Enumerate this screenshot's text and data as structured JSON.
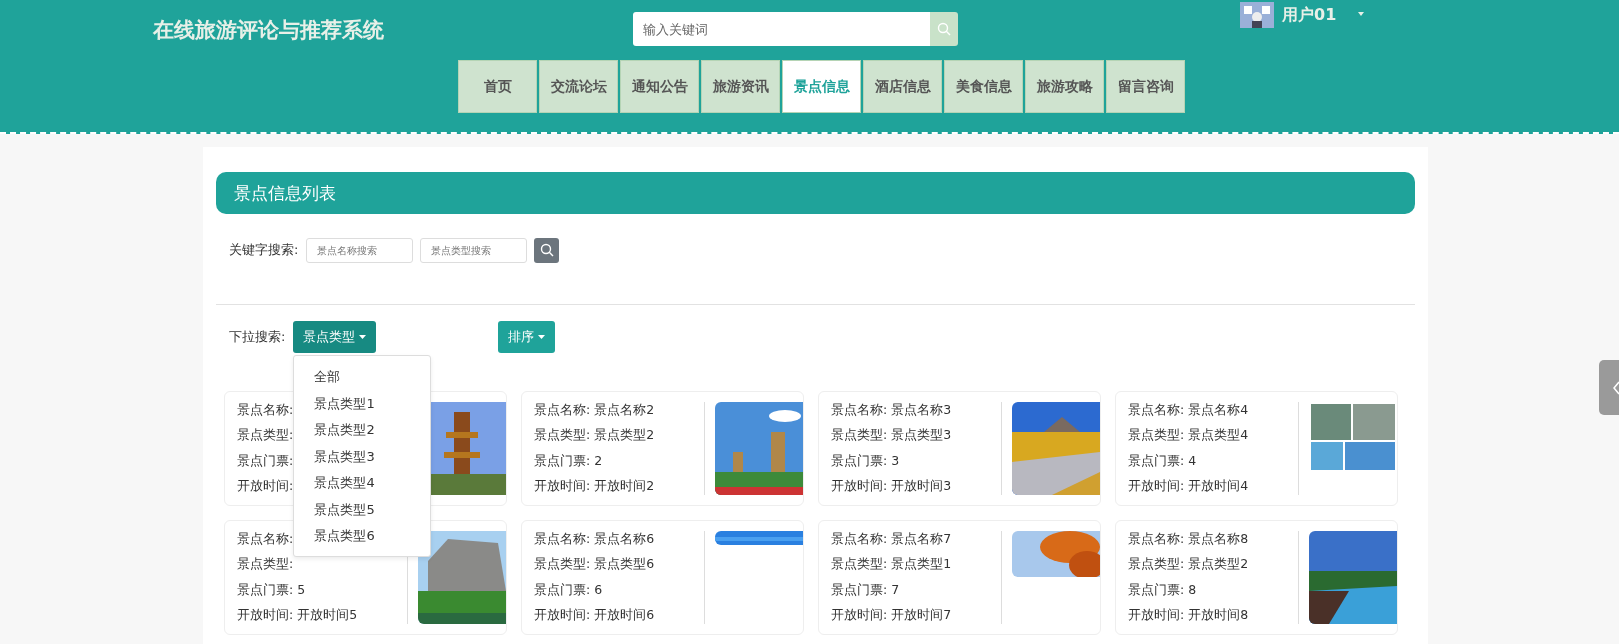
{
  "header": {
    "title": "在线旅游评论与推荐系统",
    "search": {
      "placeholder": "输入关键词"
    },
    "user": {
      "name": "用户01"
    }
  },
  "nav": [
    {
      "label": "首页",
      "selected": false
    },
    {
      "label": "交流论坛",
      "selected": false
    },
    {
      "label": "通知公告",
      "selected": false
    },
    {
      "label": "旅游资讯",
      "selected": false
    },
    {
      "label": "景点信息",
      "selected": true
    },
    {
      "label": "酒店信息",
      "selected": false
    },
    {
      "label": "美食信息",
      "selected": false
    },
    {
      "label": "旅游攻略",
      "selected": false
    },
    {
      "label": "留言咨询",
      "selected": false
    }
  ],
  "panel": {
    "title": "景点信息列表",
    "keyword_search": {
      "label": "关键字搜索:",
      "fields": [
        {
          "placeholder": "景点名称搜索"
        },
        {
          "placeholder": "景点类型搜索"
        }
      ]
    },
    "dropdown_search": {
      "label": "下拉搜索:",
      "filter": {
        "label": "景点类型",
        "expanded": true,
        "options": [
          "全部",
          "景点类型1",
          "景点类型2",
          "景点类型3",
          "景点类型4",
          "景点类型5",
          "景点类型6"
        ]
      },
      "sort": {
        "label": "排序"
      }
    },
    "cards": [
      {
        "fields": [
          {
            "label": "景点名称:"
          },
          {
            "label": "景点类型:"
          },
          {
            "label": "景点门票:"
          },
          {
            "label": "开放时间:"
          }
        ]
      },
      {
        "fields": [
          {
            "label": "景点名称:",
            "value": "景点名称2"
          },
          {
            "label": "景点类型:",
            "value": "景点类型2"
          },
          {
            "label": "景点门票:",
            "value": "2"
          },
          {
            "label": "开放时间:",
            "value": "开放时间2"
          }
        ]
      },
      {
        "fields": [
          {
            "label": "景点名称:",
            "value": "景点名称3"
          },
          {
            "label": "景点类型:",
            "value": "景点类型3"
          },
          {
            "label": "景点门票:",
            "value": "3"
          },
          {
            "label": "开放时间:",
            "value": "开放时间3"
          }
        ]
      },
      {
        "fields": [
          {
            "label": "景点名称:",
            "value": "景点名称4"
          },
          {
            "label": "景点类型:",
            "value": "景点类型4"
          },
          {
            "label": "景点门票:",
            "value": "4"
          },
          {
            "label": "开放时间:",
            "value": "开放时间4"
          }
        ]
      },
      {
        "fields": [
          {
            "label": "景点名称:"
          },
          {
            "label": "景点类型:"
          },
          {
            "label": "景点门票:",
            "value": "5"
          },
          {
            "label": "开放时间:",
            "value": "开放时间5"
          }
        ]
      },
      {
        "fields": [
          {
            "label": "景点名称:",
            "value": "景点名称6"
          },
          {
            "label": "景点类型:",
            "value": "景点类型6"
          },
          {
            "label": "景点门票:",
            "value": "6"
          },
          {
            "label": "开放时间:",
            "value": "开放时间6"
          }
        ]
      },
      {
        "fields": [
          {
            "label": "景点名称:",
            "value": "景点名称7"
          },
          {
            "label": "景点类型:",
            "value": "景点类型1"
          },
          {
            "label": "景点门票:",
            "value": "7"
          },
          {
            "label": "开放时间:",
            "value": "开放时间7"
          }
        ]
      },
      {
        "fields": [
          {
            "label": "景点名称:",
            "value": "景点名称8"
          },
          {
            "label": "景点类型:",
            "value": "景点类型2"
          },
          {
            "label": "景点门票:",
            "value": "8"
          },
          {
            "label": "开放时间:",
            "value": "开放时间8"
          }
        ]
      }
    ]
  }
}
